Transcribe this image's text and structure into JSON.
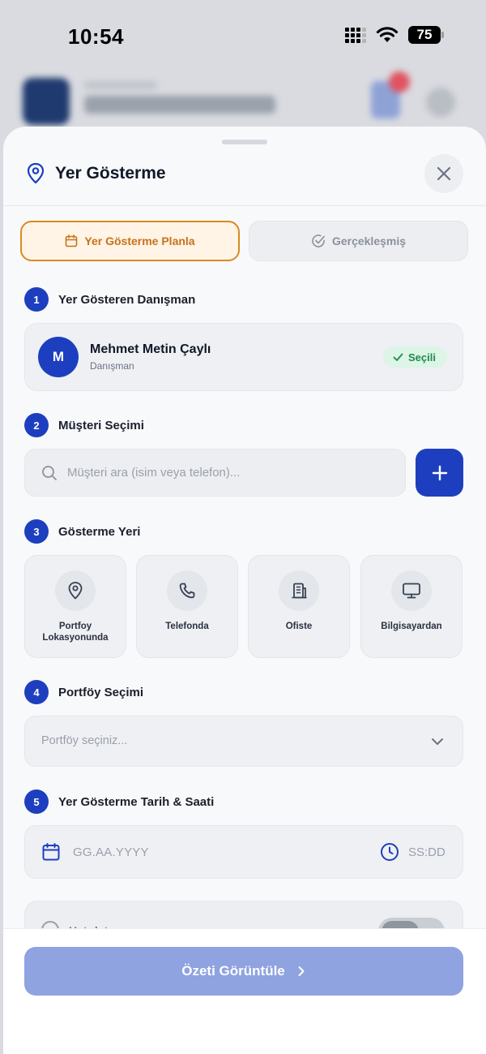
{
  "status_bar": {
    "time": "10:54",
    "battery": "75"
  },
  "sheet": {
    "title": "Yer Gösterme",
    "tabs": [
      {
        "label": "Yer Gösterme Planla",
        "active": true
      },
      {
        "label": "Gerçekleşmiş",
        "active": false
      }
    ]
  },
  "sections": {
    "advisor": {
      "step": "1",
      "title": "Yer Gösteren Danışman",
      "avatar_initial": "M",
      "name": "Mehmet Metin Çaylı",
      "role": "Danışman",
      "badge": "Seçili"
    },
    "customer": {
      "step": "2",
      "title": "Müşteri Seçimi",
      "search_placeholder": "Müşteri ara (isim veya telefon)...",
      "add_label": "+"
    },
    "location": {
      "step": "3",
      "title": "Gösterme Yeri",
      "options": [
        {
          "label": "Portfoy Lokasyonunda",
          "icon": "map-pin-icon"
        },
        {
          "label": "Telefonda",
          "icon": "phone-icon"
        },
        {
          "label": "Ofiste",
          "icon": "building-icon"
        },
        {
          "label": "Bilgisayardan",
          "icon": "monitor-icon"
        }
      ]
    },
    "portfolio": {
      "step": "4",
      "title": "Portföy Seçimi",
      "placeholder": "Portföy seçiniz..."
    },
    "datetime": {
      "step": "5",
      "title": "Yer Gösterme Tarih & Saati",
      "date_placeholder": "GG.AA.YYYY",
      "time_placeholder": "SS:DD"
    },
    "reminder": {
      "label": "Hatırlatıcı"
    }
  },
  "footer": {
    "cta_label": "Özeti Görüntüle"
  },
  "colors": {
    "primary": "#1d3fbf",
    "accent_orange": "#d98a22",
    "success": "#1f8a4c",
    "cta_disabled": "#8ea3e0"
  }
}
